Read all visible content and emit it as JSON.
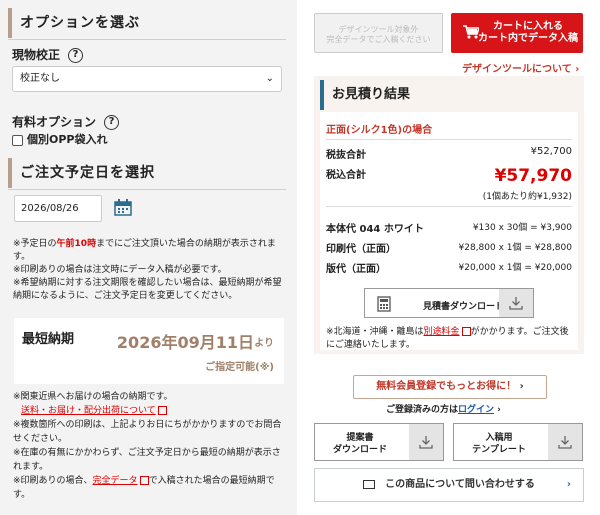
{
  "options": {
    "title": "オプションを選ぶ",
    "proof_label": "現物校正",
    "help_mark": "?",
    "proof_value": "校正なし",
    "paid_label": "有料オプション",
    "paid_check_label": "個別OPP袋入れ"
  },
  "date": {
    "title": "ご注文予定日を選択",
    "value": "2026/08/26",
    "note1_pre": "※予定日の",
    "note1_red": "午前10時",
    "note1_post": "までにご注文頂いた場合の納期が表示されます。",
    "note2": "※印刷ありの場合は注文時にデータ入稿が必要です。",
    "note3": "※希望納期に対する注文期限を確認したい場合は、最短納期が希望納期になるように、ご注文予定日を変更してください。"
  },
  "shortest": {
    "label": "最短納期",
    "date": "2026年09月11日",
    "yori": "より",
    "ok": "ご指定可能(※)"
  },
  "bottom_notes": {
    "n1": "※関東近県へお届けの場合の納期です。",
    "link1": "送料・お届け・配分出荷について",
    "n2": "※複数箇所への印刷は、上記よりお日にちがかかりますのでお問合せください。",
    "n3": "※在庫の有無にかかわらず、ご注文予定日から最短の納期が表示されます。",
    "n4_pre": "※印刷ありの場合、",
    "n4_link": "完全データ",
    "n4_post": "で入稿された場合の最短納期です。"
  },
  "right": {
    "disabled_btn_line1": "デザインツール対象外",
    "disabled_btn_line2": "完全データでご入稿ください",
    "cart_line1": "カートに入れる",
    "cart_line2": "カート内でデータ入稿",
    "design_link": "デザインツールについて",
    "quote_title": "お見積り結果",
    "print_type": "正面(シルク1色)の場合",
    "tax_ex_label": "税抜合計",
    "tax_ex_value": "¥52,700",
    "tax_in_label": "税込合計",
    "tax_in_value": "¥57,970",
    "per_unit": "(1個あたり約¥1,932)",
    "item_label": "本体代 044 ホワイト",
    "item_value": "¥130 x 30個 = ¥3,900",
    "print_label": "印刷代（正面）",
    "print_value": "¥28,800 x 1個 = ¥28,800",
    "plate_label": "版代（正面）",
    "plate_value": "¥20,000 x 1個 = ¥20,000",
    "dl_label": "見積書ダウンロード",
    "ship_note_pre": "※北海道・沖縄・離島は",
    "ship_note_link": "別途料金",
    "ship_note_post": "がかかります。ご注文後にご連絡いたします。",
    "register_btn": "無料会員登録でもっとお得に！",
    "registered_pre": "ご登録済みの方は",
    "login_link": "ログイン",
    "proposal_line1": "提案書",
    "proposal_line2": "ダウンロード",
    "template_line1": "入稿用",
    "template_line2": "テンプレート",
    "contact": "この商品について問い合わせする"
  },
  "colors": {
    "accent_red": "#d71518",
    "brown": "#a08068",
    "blue_bar": "#2a6d8e"
  }
}
